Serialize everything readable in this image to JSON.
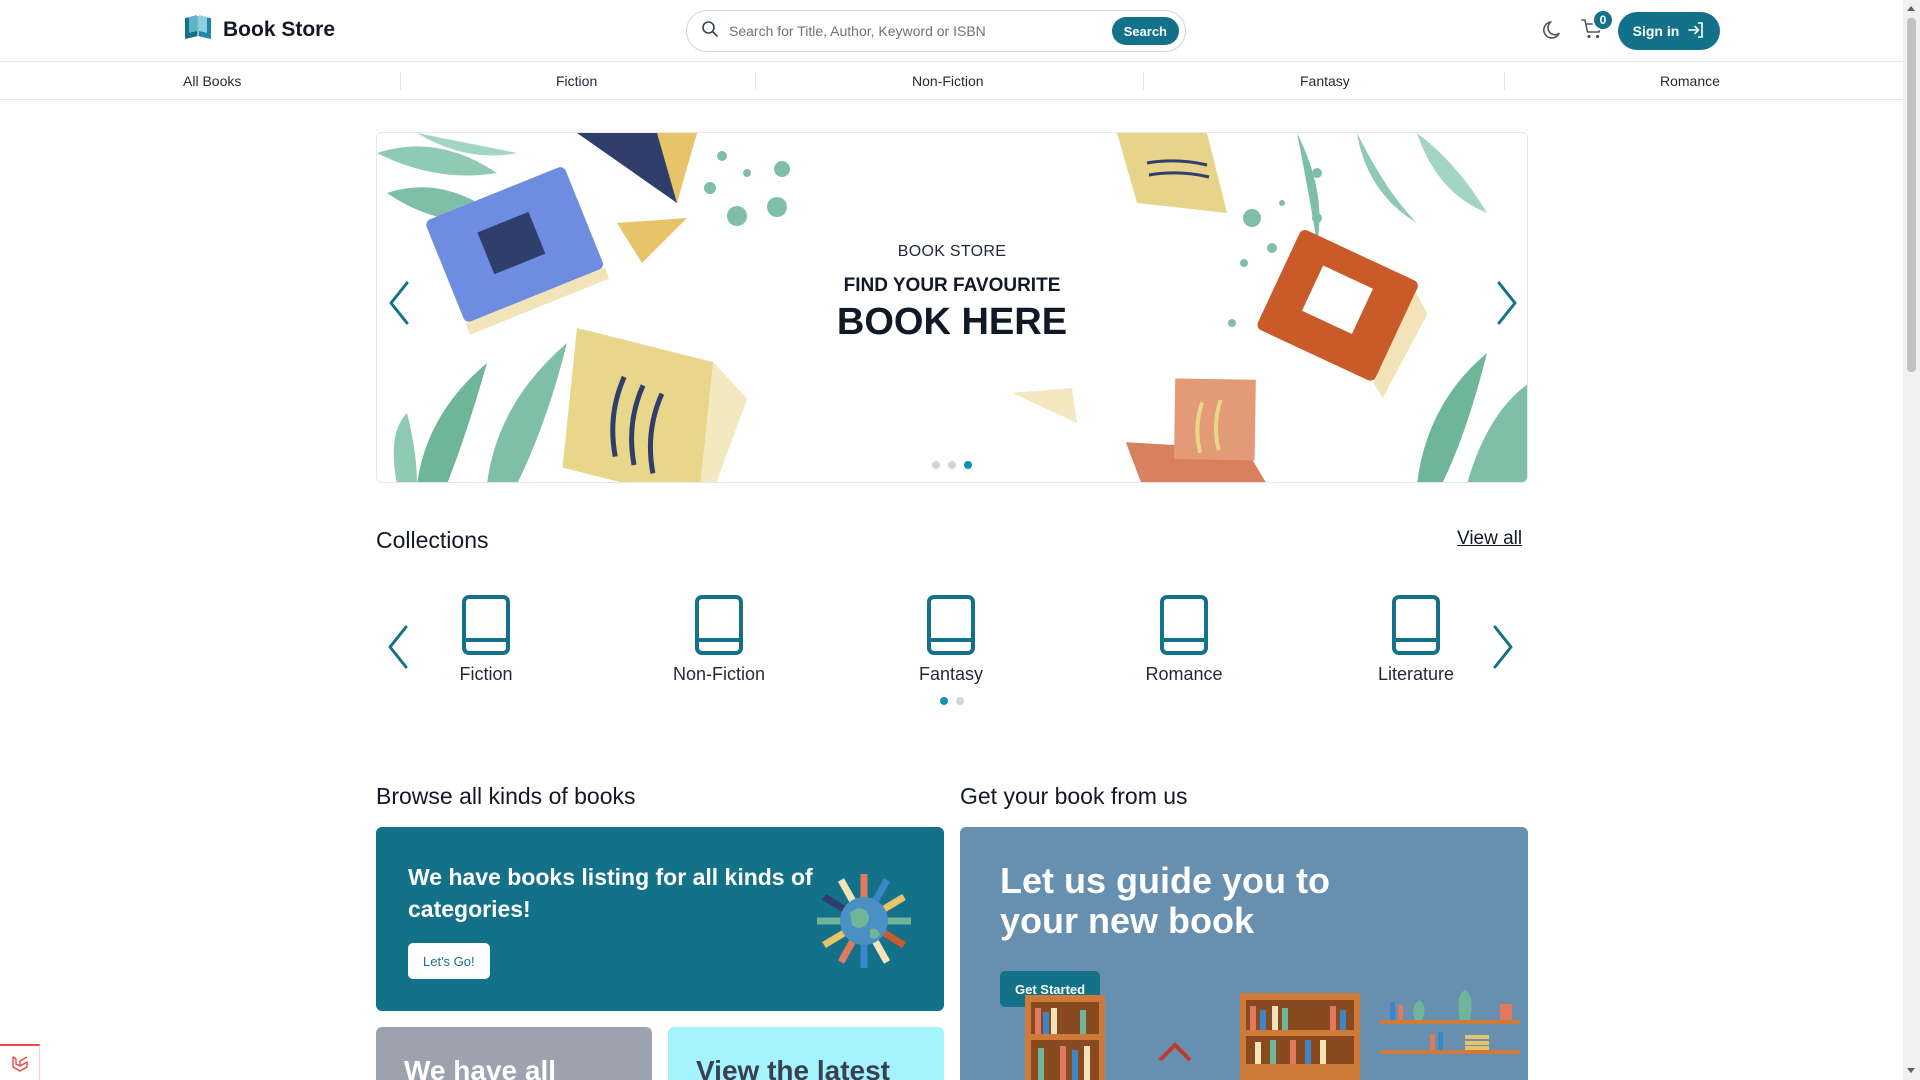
{
  "app": {
    "title": "Book Store"
  },
  "search": {
    "placeholder": "Search for Title, Author, Keyword or ISBN",
    "button_label": "Search"
  },
  "header": {
    "cart_count": "0",
    "signin_label": "Sign in"
  },
  "nav": {
    "items": [
      "All Books",
      "Fiction",
      "Non-Fiction",
      "Fantasy",
      "Romance"
    ]
  },
  "hero": {
    "kicker": "BOOK STORE",
    "subtitle": "FIND YOUR FAVOURITE",
    "title": "BOOK HERE",
    "slide_count": 3,
    "active_slide": 3
  },
  "collections": {
    "title": "Collections",
    "view_all_label": "View all",
    "items": [
      "Fiction",
      "Non-Fiction",
      "Fantasy",
      "Romance",
      "Literature"
    ],
    "page_count": 2,
    "active_page": 1
  },
  "browse": {
    "title": "Browse all kinds of books",
    "card_text": "We have books listing for all kinds of categories!",
    "button_label": "Let's Go!",
    "card2_text": "We have all",
    "card3_text": "View the latest"
  },
  "guide": {
    "title": "Get your book from us",
    "card_text": "Let us guide you to your new book",
    "button_label": "Get Started"
  },
  "colors": {
    "primary": "#13718a",
    "guide_card": "#668fb0",
    "card_gray": "#9ca3af",
    "card_cyan": "#a5f3fc",
    "dot_active": "#0e90b3"
  },
  "icons": [
    "book-store-logo-icon",
    "search-icon",
    "moon-icon",
    "cart-icon",
    "sign-in-arrow-icon",
    "book-icon",
    "chevron-left-icon",
    "chevron-right-icon"
  ]
}
